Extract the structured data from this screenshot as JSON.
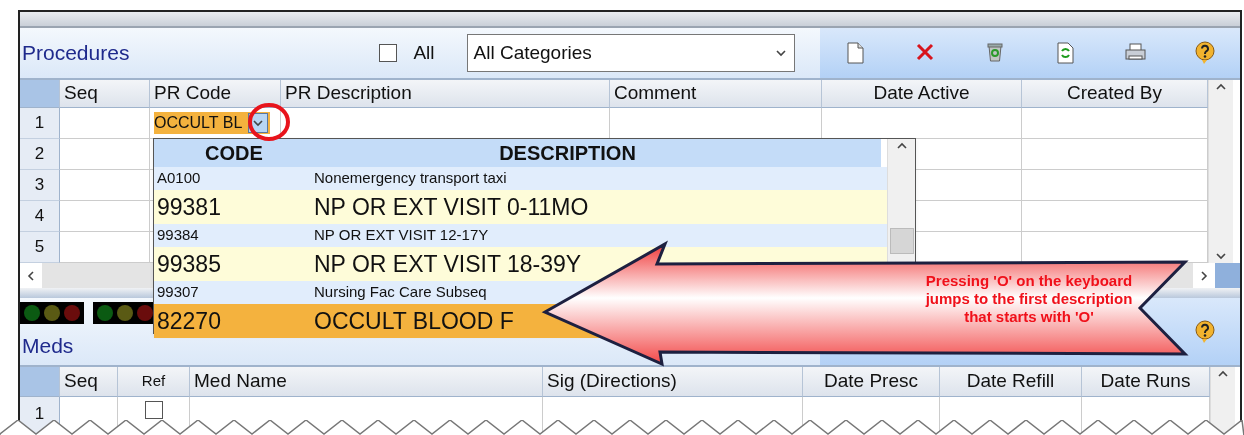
{
  "procedures": {
    "title": "Procedures",
    "all_checkbox": {
      "label": "All",
      "checked": false
    },
    "category_select": {
      "value": "All Categories"
    },
    "table": {
      "columns": [
        "Seq",
        "PR Code",
        "PR Description",
        "Comment",
        "Date Active",
        "Created By"
      ],
      "rows": [
        {
          "number": "1",
          "pr_code": "OCCULT BL"
        },
        {
          "number": "2"
        },
        {
          "number": "3"
        },
        {
          "number": "4"
        },
        {
          "number": "5"
        }
      ]
    }
  },
  "status_lights": [
    {
      "lights": [
        {
          "color": "#0b5a12"
        },
        {
          "color": "#5a5a14"
        },
        {
          "color": "#6a0c0c"
        }
      ]
    },
    {
      "lights": [
        {
          "color": "#0b5a12"
        },
        {
          "color": "#5a5a14"
        },
        {
          "color": "#6a0c0c"
        }
      ]
    }
  ],
  "meds": {
    "title": "Meds",
    "table": {
      "columns": [
        "Seq",
        "Ref",
        "Med Name",
        "Sig (Directions)",
        "Date Presc",
        "Date Refill",
        "Date Runs"
      ],
      "rows": [
        {
          "number": "1",
          "ref_checked": false
        }
      ]
    }
  },
  "code_dropdown": {
    "columns": [
      "CODE",
      "DESCRIPTION"
    ],
    "items": [
      {
        "code": "A0100",
        "description": "Nonemergency transport taxi",
        "kind": "small",
        "selected": false
      },
      {
        "code": "99381",
        "description": "NP OR EXT VISIT 0-11MO",
        "kind": "large",
        "selected": false
      },
      {
        "code": "99384",
        "description": "NP OR EXT VISIT 12-17Y",
        "kind": "small",
        "selected": false
      },
      {
        "code": "99385",
        "description": "NP OR EXT VISIT 18-39Y",
        "kind": "large",
        "selected": false
      },
      {
        "code": "99307",
        "description": "Nursing Fac Care Subseq",
        "kind": "small",
        "selected": false
      },
      {
        "code": "82270",
        "description": "OCCULT BLOOD F",
        "kind": "large",
        "selected": true
      }
    ]
  },
  "callout": {
    "text": "Pressing 'O' on the keyboard jumps to the first description that starts with 'O'"
  }
}
